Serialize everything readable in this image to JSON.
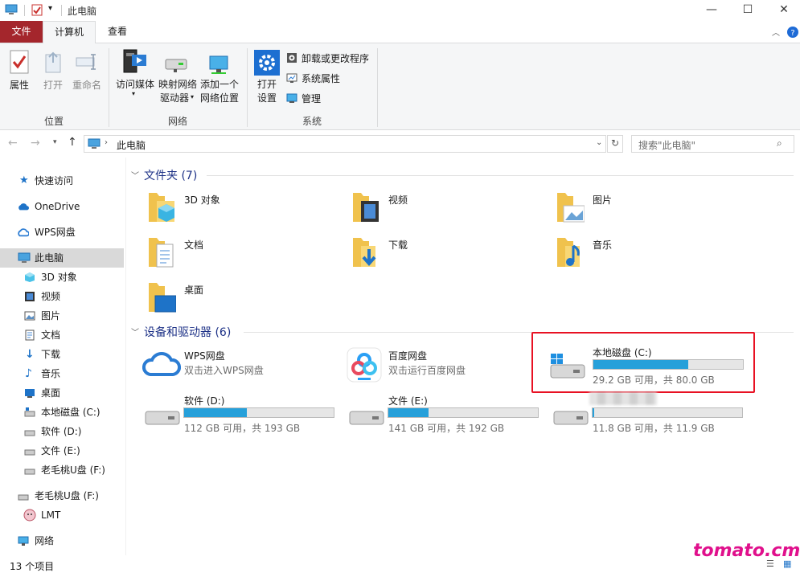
{
  "window": {
    "title": "此电脑",
    "min": "—",
    "max": "☐",
    "close": "✕"
  },
  "tabs": {
    "file": "文件",
    "computer": "计算机",
    "view": "查看"
  },
  "ribbon": {
    "location": {
      "group": "位置",
      "properties": "属性",
      "open": "打开",
      "rename": "重命名"
    },
    "network": {
      "group": "网络",
      "access_media": "访问媒体",
      "map_drive_1": "映射网络",
      "map_drive_2": "驱动器",
      "add_location_1": "添加一个",
      "add_location_2": "网络位置"
    },
    "system": {
      "group": "系统",
      "open_settings_1": "打开",
      "open_settings_2": "设置",
      "uninstall": "卸载或更改程序",
      "sys_props": "系统属性",
      "manage": "管理"
    }
  },
  "address": {
    "path": "此电脑",
    "search_placeholder": "搜索\"此电脑\""
  },
  "sidebar": {
    "quick_access": "快速访问",
    "onedrive": "OneDrive",
    "wps": "WPS网盘",
    "this_pc": "此电脑",
    "items": [
      "3D 对象",
      "视频",
      "图片",
      "文档",
      "下载",
      "音乐",
      "桌面",
      "本地磁盘 (C:)",
      "软件 (D:)",
      "文件 (E:)",
      "老毛桃U盘 (F:)"
    ],
    "usb": "老毛桃U盘 (F:)",
    "lmt": "LMT",
    "network": "网络"
  },
  "folders_section": {
    "title": "文件夹 (7)",
    "items": [
      "3D 对象",
      "视频",
      "图片",
      "文档",
      "下载",
      "音乐",
      "桌面"
    ]
  },
  "devices_section": {
    "title": "设备和驱动器 (6)",
    "wps": {
      "name": "WPS网盘",
      "desc": "双击进入WPS网盘"
    },
    "baidu": {
      "name": "百度网盘",
      "desc": "双击运行百度网盘"
    },
    "drives": [
      {
        "name": "本地磁盘 (C:)",
        "info": "29.2 GB 可用，共 80.0 GB",
        "used": 0.635
      },
      {
        "name": "软件 (D:)",
        "info": "112 GB 可用，共 193 GB",
        "used": 0.42
      },
      {
        "name": "文件 (E:)",
        "info": "141 GB 可用，共 192 GB",
        "used": 0.27
      },
      {
        "name": "",
        "info": "11.8 GB 可用，共 11.9 GB",
        "used": 0.01
      }
    ]
  },
  "status": {
    "count": "13 个项目"
  },
  "watermark": "tomato.cm",
  "colors": {
    "accent": "#26a0da",
    "file_tab": "#a4262c",
    "highlight_box": "#e81123",
    "section_header": "#1e3287"
  }
}
